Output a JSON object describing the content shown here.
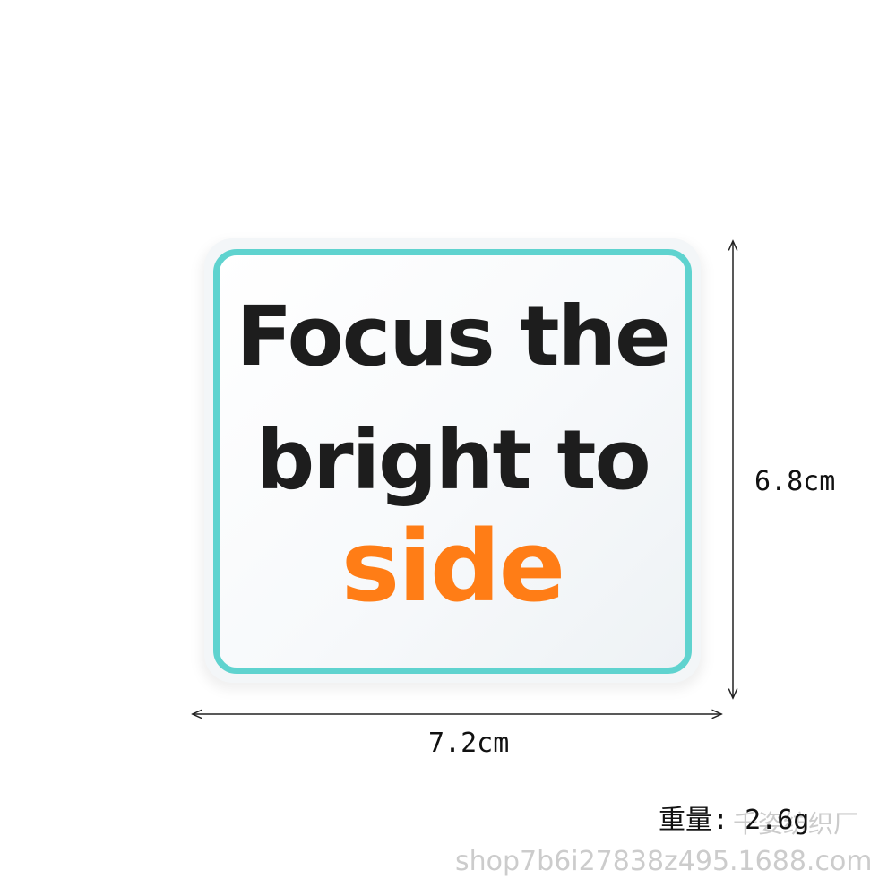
{
  "patch": {
    "line1": "Focus the",
    "line2": "bright to",
    "line3": "side",
    "border_color": "#5fd3cf",
    "text_color": "#1d1d1d",
    "accent_color": "#ff7d16"
  },
  "dimensions": {
    "height_label": "6.8cm",
    "width_label": "7.2cm"
  },
  "weight_label": "重量: 2.6g",
  "watermark": {
    "shop_name": "千姿纺织厂",
    "url": "shop7b6i27838z495.1688.com"
  }
}
